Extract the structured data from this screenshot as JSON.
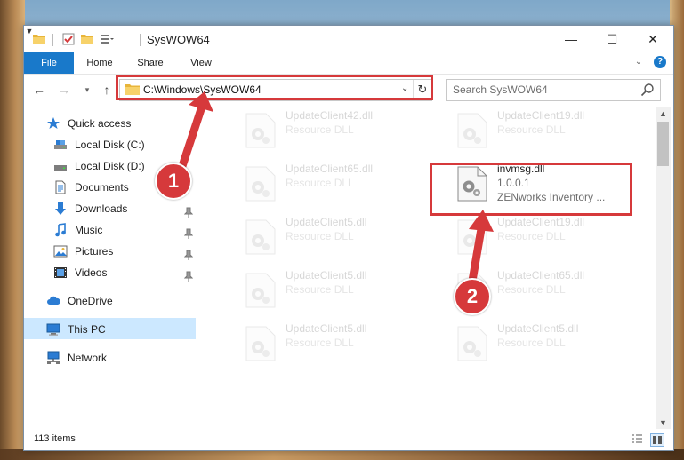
{
  "window": {
    "title": "SysWOW64"
  },
  "titlebar": {
    "min": "—",
    "max": "☐",
    "close": "✕"
  },
  "ribbon": {
    "tabs": [
      "File",
      "Home",
      "Share",
      "View"
    ],
    "help": "?"
  },
  "navigation": {
    "address": "C:\\Windows\\SysWOW64",
    "search_placeholder": "Search SysWOW64"
  },
  "sidebar": {
    "items": [
      {
        "label": "Quick access",
        "icon": "star-icon"
      },
      {
        "label": "Local Disk (C:)",
        "icon": "drive-icon"
      },
      {
        "label": "Local Disk (D:)",
        "icon": "drive-icon"
      },
      {
        "label": "Documents",
        "icon": "documents-icon"
      },
      {
        "label": "Downloads",
        "icon": "download-icon"
      },
      {
        "label": "Music",
        "icon": "music-icon"
      },
      {
        "label": "Pictures",
        "icon": "pictures-icon"
      },
      {
        "label": "Videos",
        "icon": "videos-icon"
      },
      {
        "label": "OneDrive",
        "icon": "cloud-icon"
      },
      {
        "label": "This PC",
        "icon": "computer-icon",
        "selected": true
      },
      {
        "label": "Network",
        "icon": "network-icon"
      }
    ]
  },
  "files": [
    {
      "name": "UpdateClient42.dll",
      "type": "Resource DLL"
    },
    {
      "name": "UpdateClient19.dll",
      "type": "Resource DLL"
    },
    {
      "name": "UpdateClient65.dll",
      "type": "Resource DLL"
    },
    {
      "name": "invmsg.dll",
      "version": "1.0.0.1",
      "company": "ZENworks Inventory ...",
      "highlighted": true
    },
    {
      "name": "UpdateClient5.dll",
      "type": "Resource DLL"
    },
    {
      "name": "UpdateClient19.dll",
      "type": "Resource DLL"
    },
    {
      "name": "UpdateClient5.dll",
      "type": "Resource DLL"
    },
    {
      "name": "UpdateClient65.dll",
      "type": "Resource DLL"
    },
    {
      "name": "UpdateClient5.dll",
      "type": "Resource DLL"
    },
    {
      "name": "UpdateClient5.dll",
      "type": "Resource DLL"
    }
  ],
  "status": {
    "item_count": "113 items"
  },
  "annotations": {
    "badge1": "1",
    "badge2": "2",
    "accent_color": "#d6393b"
  }
}
